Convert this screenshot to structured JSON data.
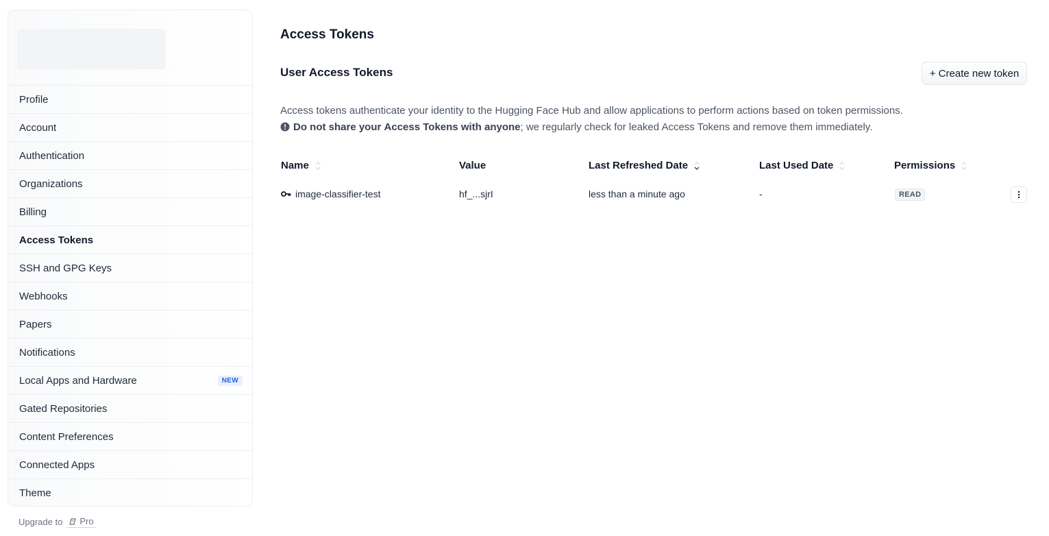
{
  "sidebar": {
    "items": [
      {
        "label": "Profile"
      },
      {
        "label": "Account"
      },
      {
        "label": "Authentication"
      },
      {
        "label": "Organizations"
      },
      {
        "label": "Billing"
      },
      {
        "label": "Access Tokens",
        "active": true
      },
      {
        "label": "SSH and GPG Keys"
      },
      {
        "label": "Webhooks"
      },
      {
        "label": "Papers"
      },
      {
        "label": "Notifications"
      },
      {
        "label": "Local Apps and Hardware",
        "badge": "NEW"
      },
      {
        "label": "Gated Repositories"
      },
      {
        "label": "Content Preferences"
      },
      {
        "label": "Connected Apps"
      },
      {
        "label": "Theme"
      }
    ],
    "upgrade_label": "Upgrade to",
    "pro_label": "Pro"
  },
  "main": {
    "title": "Access Tokens",
    "section_title": "User Access Tokens",
    "create_button": "+ Create new token",
    "description": "Access tokens authenticate your identity to the Hugging Face Hub and allow applications to perform actions based on token permissions.",
    "warning_bold_1": "Do not share your",
    "warning_bold_2": "Access Tokens",
    "warning_bold_3": "with anyone",
    "warning_rest": "; we regularly check for leaked Access Tokens and remove them immediately."
  },
  "table": {
    "columns": [
      "Name",
      "Value",
      "Last Refreshed Date",
      "Last Used Date",
      "Permissions"
    ],
    "rows": [
      {
        "name": "image-classifier-test",
        "value": "hf_...sjrI",
        "last_refreshed": "less than a minute ago",
        "last_used": "-",
        "permission": "READ"
      }
    ]
  },
  "colors": {
    "accent_blue": "#2563eb",
    "border": "#eceef2"
  }
}
